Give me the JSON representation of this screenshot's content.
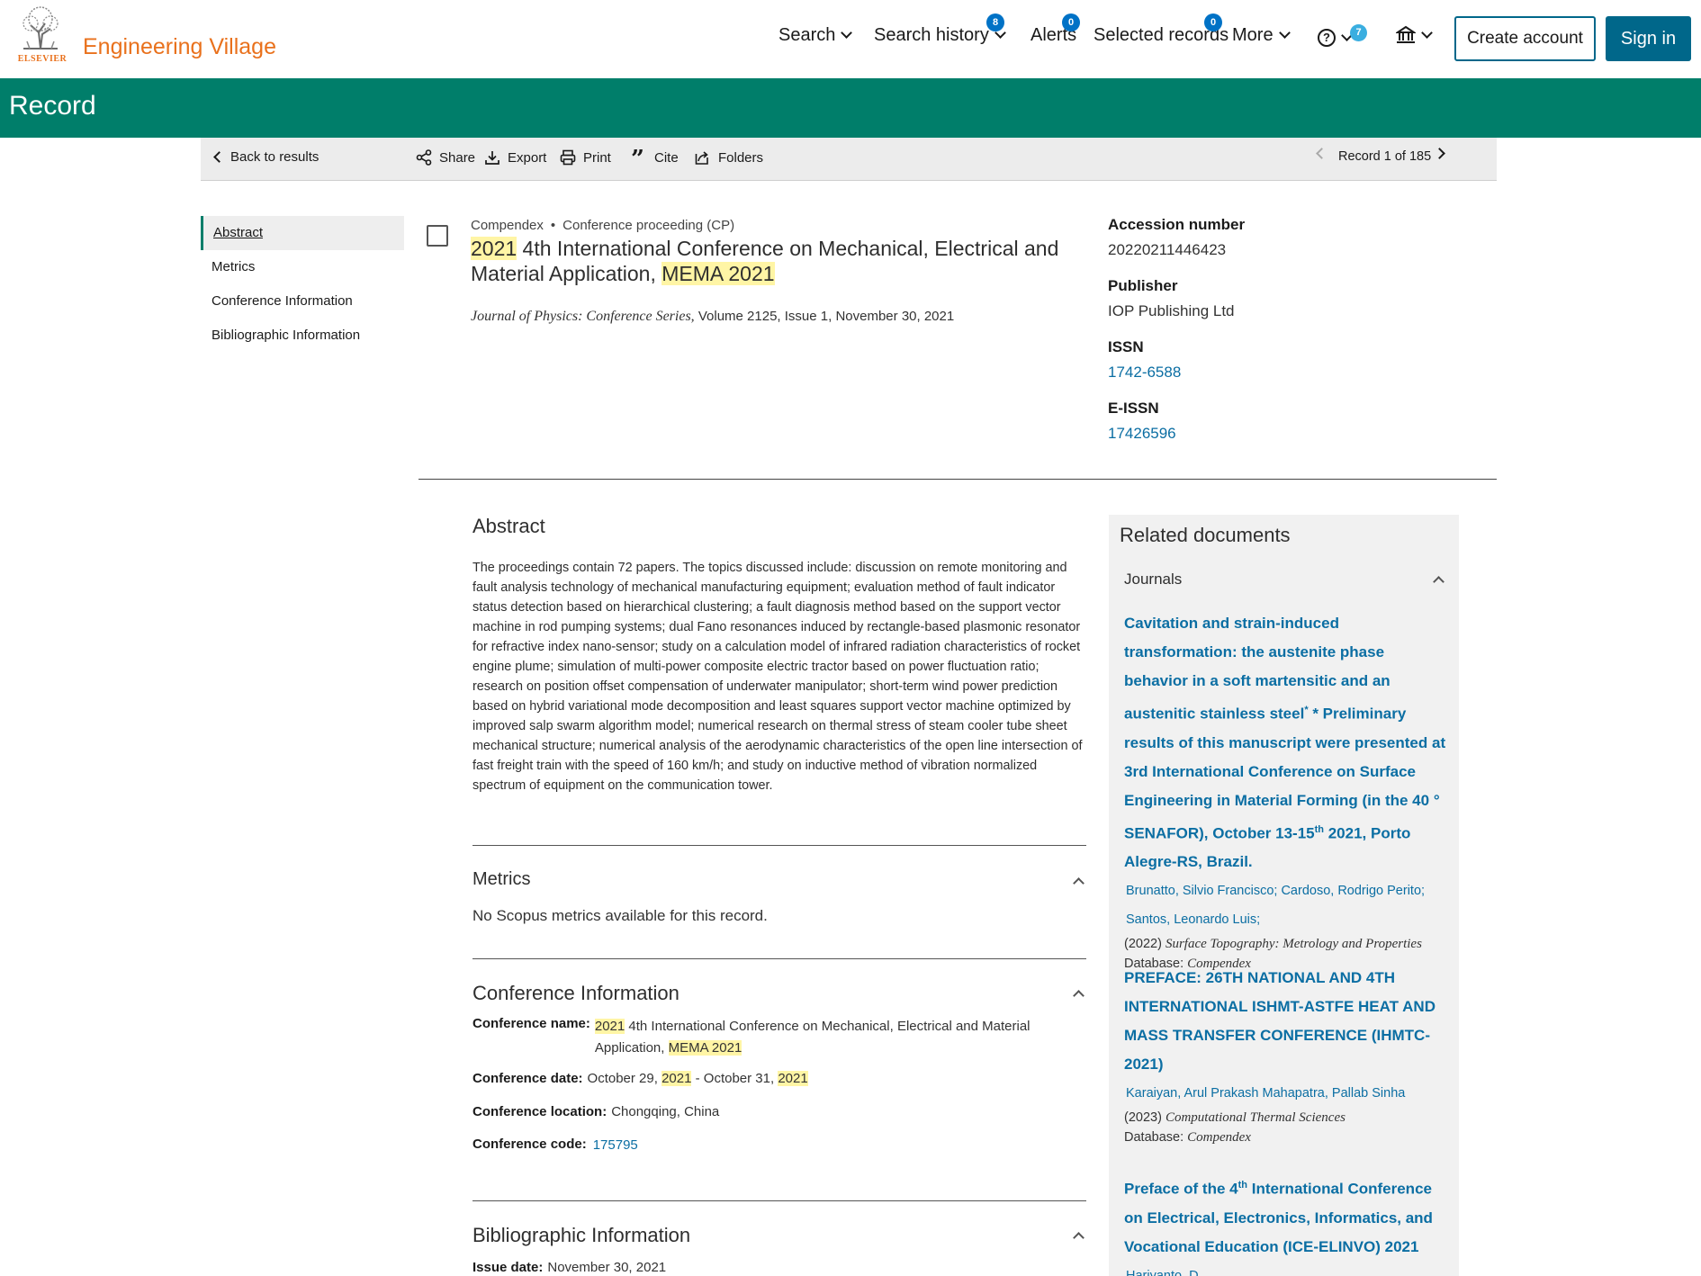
{
  "brand": {
    "publisher": "ELSEVIER",
    "product": "Engineering Village"
  },
  "nav": {
    "search": "Search",
    "history": "Search history",
    "history_badge": "8",
    "alerts": "Alerts",
    "alerts_badge": "0",
    "selected": "Selected records",
    "selected_badge": "0",
    "more": "More",
    "help_badge": "7",
    "create_account": "Create account",
    "sign_in": "Sign in"
  },
  "page_title": "Record",
  "toolbar": {
    "back": "Back to results",
    "share": "Share",
    "export": "Export",
    "print": "Print",
    "cite": "Cite",
    "folders": "Folders",
    "record_pos": "Record 1 of 185"
  },
  "toc": [
    "Abstract",
    "Metrics",
    "Conference Information",
    "Bibliographic Information"
  ],
  "record": {
    "database": "Compendex",
    "doctype": "Conference proceeding (CP)",
    "title_hl1": "2021",
    "title_mid": " 4th International Conference on Mechanical, Electrical and Material Application, ",
    "title_hl2": "MEMA 2021",
    "journal": "Journal of Physics: Conference Series,",
    "issue_info": " Volume 2125, Issue 1, November 30, 2021"
  },
  "meta": {
    "accession_label": "Accession number",
    "accession": "20220211446423",
    "publisher_label": "Publisher",
    "publisher": "IOP Publishing Ltd",
    "issn_label": "ISSN",
    "issn": "1742-6588",
    "eissn_label": "E-ISSN",
    "eissn": "17426596"
  },
  "abstract": {
    "heading": "Abstract",
    "text": "The proceedings contain 72 papers. The topics discussed include: discussion on remote monitoring and fault analysis technology of mechanical manufacturing equipment; evaluation method of fault indicator status detection based on hierarchical clustering; a fault diagnosis method based on the support vector machine in rod pumping systems; dual Fano resonances induced by rectangle-based plasmonic resonator for refractive index nano-sensor; study on a calculation model of infrared radiation characteristics of rocket engine plume; simulation of multi-power composite electric tractor based on power fluctuation ratio; research on position offset compensation of underwater manipulator; short-term wind power prediction based on hybrid variational mode decomposition and least squares support vector machine optimized by improved salp swarm algorithm model; numerical research on thermal stress of steam cooler tube sheet mechanical structure; numerical analysis of the aerodynamic characteristics of the open line intersection of fast freight train with the speed of 160 km/h; and study on inductive method of vibration normalized spectrum of equipment on the communication tower."
  },
  "metrics": {
    "heading": "Metrics",
    "text": "No Scopus metrics available for this record."
  },
  "conference": {
    "heading": "Conference Information",
    "name_label": "Conference name:",
    "name_hl1": "2021",
    "name_mid": " 4th International Conference on Mechanical, Electrical and Material Application, ",
    "name_hl2": "MEMA 2021",
    "date_label": "Conference date:",
    "date_a": "October 29, ",
    "date_y1": "2021",
    "date_b": " - October 31, ",
    "date_y2": "2021",
    "location_label": "Conference location:",
    "location": "Chongqing, China",
    "code_label": "Conference code:",
    "code": "175795"
  },
  "bibliographic": {
    "heading": "Bibliographic Information",
    "issue_label": "Issue date:",
    "issue": "November 30, 2021"
  },
  "related": {
    "heading": "Related documents",
    "group": "Journals",
    "docs": [
      {
        "t1": "Cavitation and strain-induced transformation: the austenite phase behavior in a soft martensitic and an austenitic stainless steel",
        "sup1": "*",
        "t2": " * Preliminary results of this manuscript were presented at 3rd International Conference on Surface Engineering in Material Forming (in the 40 ° SENAFOR), October 13-15",
        "sup2": "th",
        "t3": " 2021, Porto Alegre-RS, Brazil.",
        "authors": "Brunatto, Silvio Francisco; Cardoso, Rodrigo Perito; Santos, Leonardo Luis;",
        "year": "(2022) ",
        "journal": "Surface Topography: Metrology and Properties",
        "db_label": "Database: ",
        "db": "Compendex"
      },
      {
        "t1": "PREFACE: 26TH NATIONAL AND 4TH INTERNATIONAL ISHMT-ASTFE HEAT AND MASS TRANSFER CONFERENCE (IHMTC-2021)",
        "authors": "Karaiyan, Arul Prakash Mahapatra, Pallab Sinha",
        "year": "(2023) ",
        "journal": "Computational Thermal Sciences",
        "db_label": "Database: ",
        "db": "Compendex"
      },
      {
        "t1": "Preface of the 4",
        "sup1": "th",
        "t2": " International Conference on Electrical, Electronics, Informatics, and Vocational Education (ICE-ELINVO) 2021",
        "authors": "Hariyanto, D."
      }
    ]
  }
}
